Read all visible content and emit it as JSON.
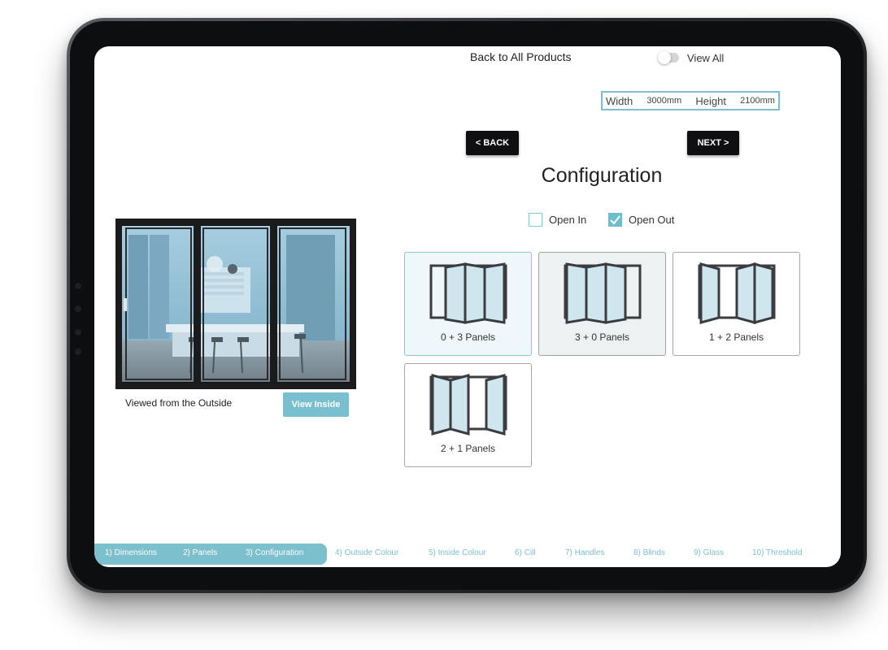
{
  "header": {
    "back_link": "Back to All Products",
    "view_all_label": "View All",
    "view_all_on": false
  },
  "dimensions": {
    "width_label": "Width",
    "width_value": "3000mm",
    "height_label": "Height",
    "height_value": "2100mm"
  },
  "nav": {
    "back_label": "< BACK",
    "next_label": "NEXT >"
  },
  "page_title": "Configuration",
  "opening": {
    "open_in": {
      "label": "Open In",
      "checked": false
    },
    "open_out": {
      "label": "Open Out",
      "checked": true
    }
  },
  "configs": [
    {
      "label": "0 + 3 Panels",
      "state": "selected"
    },
    {
      "label": "3 + 0 Panels",
      "state": "hover"
    },
    {
      "label": "1 + 2 Panels",
      "state": "normal"
    },
    {
      "label": "2 + 1 Panels",
      "state": "normal"
    }
  ],
  "preview": {
    "caption": "Viewed from the Outside",
    "view_inside_label": "View Inside"
  },
  "steps": [
    {
      "label": "1) Dimensions",
      "completed": true
    },
    {
      "label": "2) Panels",
      "completed": true
    },
    {
      "label": "3) Configuration",
      "completed": true
    },
    {
      "label": "4) Outside Colour",
      "completed": false
    },
    {
      "label": "5) Inside Colour",
      "completed": false
    },
    {
      "label": "6) Cill",
      "completed": false
    },
    {
      "label": "7) Handles",
      "completed": false
    },
    {
      "label": "8) Blinds",
      "completed": false
    },
    {
      "label": "9) Glass",
      "completed": false
    },
    {
      "label": "10) Threshold",
      "completed": false
    }
  ],
  "colors": {
    "accent": "#7cbfcd",
    "frame": "#3a3c40",
    "glass": "#cfe6ee",
    "button_dark": "#0f0f12"
  }
}
